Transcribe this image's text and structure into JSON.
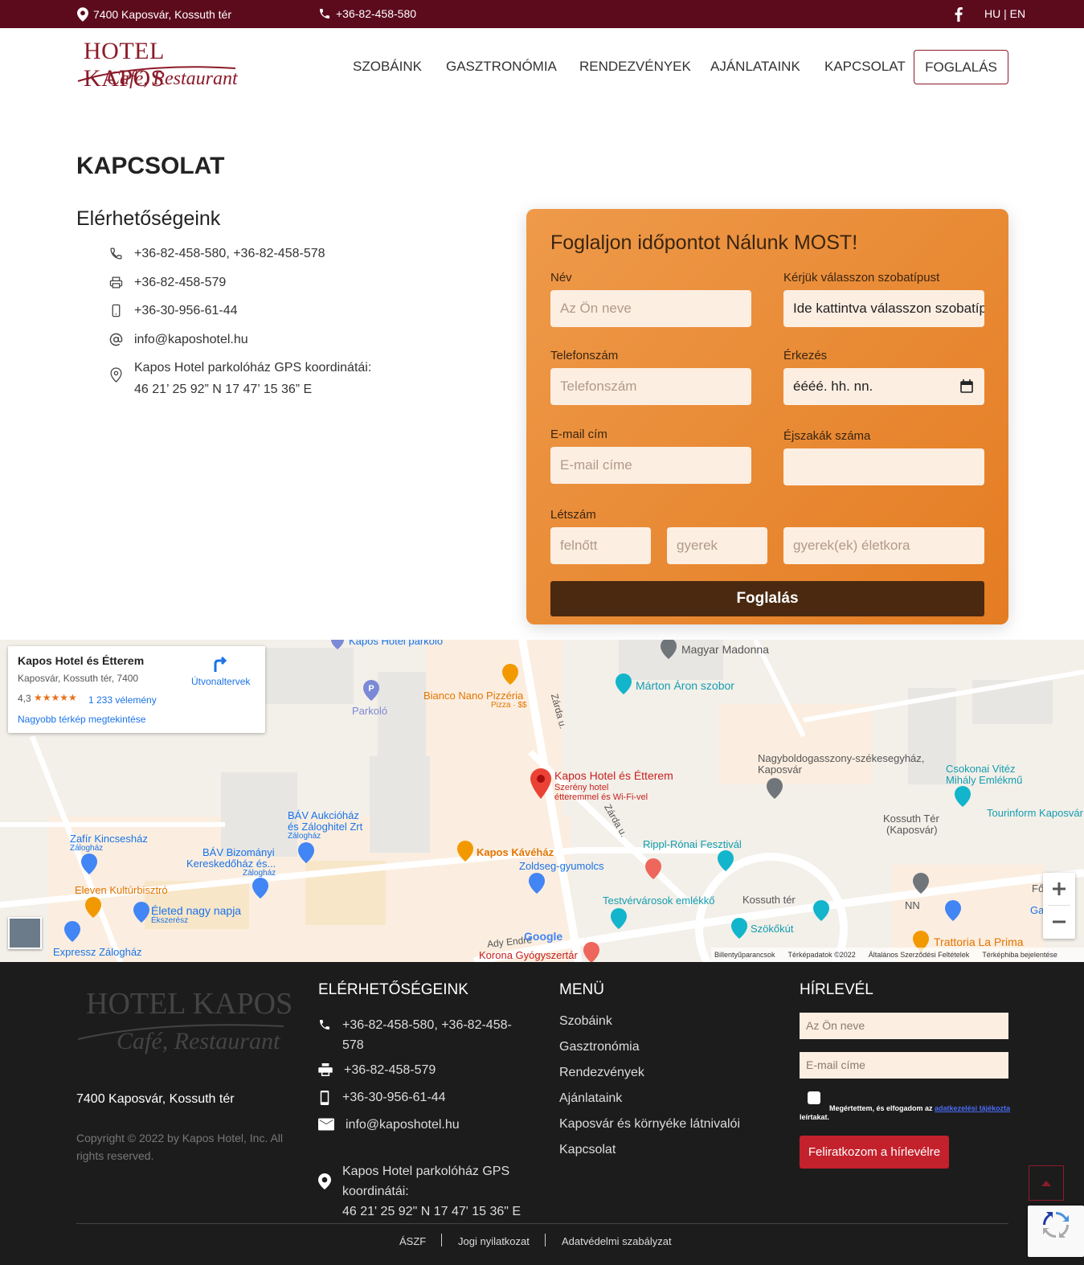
{
  "topbar": {
    "address": "7400 Kaposvár, Kossuth tér",
    "phone": "+36-82-458-580",
    "lang": "HU | EN"
  },
  "logo": {
    "title": "HOTEL KAPOS",
    "subtitle": "Café, Restaurant"
  },
  "nav": {
    "items": [
      "SZOBÁINK",
      "GASZTRONÓMIA",
      "RENDEZVÉNYEK",
      "AJÁNLATAINK",
      "KAPCSOLAT"
    ],
    "cta": "FOGLALÁS"
  },
  "page_title": "KAPCSOLAT",
  "contacts": {
    "heading": "Elérhetőségeink",
    "phone": "+36-82-458-580, +36-82-458-578",
    "fax": "+36-82-458-579",
    "mobile": "+36-30-956-61-44",
    "email": "info@kaposhotel.hu",
    "gps_label": "Kapos Hotel parkolóház GPS koordinátái:",
    "gps_value": "46 21’ 25 92” N 17 47’ 15 36” E"
  },
  "booking": {
    "title": "Foglaljon időpontot Nálunk MOST!",
    "name_label": "Név",
    "name_placeholder": "Az Ön neve",
    "room_label": "Kérjük válasszon szobatípust",
    "room_value": "Ide kattintva válasszon szobatípust",
    "phone_label": "Telefonszám",
    "phone_placeholder": "Telefonszám",
    "arrival_label": "Érkezés",
    "arrival_value": "éééé. hh. nn.",
    "email_label": "E-mail cím",
    "email_placeholder": "E-mail címe",
    "nights_label": "Éjszakák száma",
    "nights_value": "",
    "guests_label": "Létszám",
    "adult_placeholder": "felnőtt",
    "child_placeholder": "gyerek",
    "child_age_placeholder": "gyerek(ek) életkora",
    "submit": "Foglalás"
  },
  "map": {
    "card_title": "Kapos Hotel és Étterem",
    "card_address": "Kaposvár, Kossuth tér, 7400",
    "card_rating": "4,3",
    "card_stars": "★★★★★",
    "card_reviews": "1 233 vélemény",
    "card_link": "Nagyobb térkép megtekintése",
    "card_directions": "Útvonaltervek",
    "pin_title": "Kapos Hotel és Étterem",
    "pin_sub1": "Szerény hotel",
    "pin_sub2": "étteremmel és Wi-Fi-vel",
    "labels": {
      "parkolo_top": "Kapos Hotel parkoló",
      "madonna": "Magyar Madonna",
      "marton": "Márton Áron szobor",
      "bianco": "Bianco Nano Pizzéria",
      "bianco_sub": "Pizza · $$",
      "parkolo": "Parkoló",
      "zarda1": "Zárda u.",
      "zarda2": "Zárda u.",
      "nagyboldog1": "Nagyboldogasszony-székesegyház,",
      "nagyboldog2": "Kaposvár",
      "csokonai1": "Csokonai Vitéz",
      "csokonai2": "Mihály Emlékmű",
      "tourinform": "Tourinform Kaposvár",
      "kossuth_ter1": "Kossuth Tér",
      "kossuth_ter2": "(Kaposvár)",
      "bav1": "BÁV Aukcióház",
      "bav2": "és Záloghitel Zrt",
      "bav_sub": "Zálogház",
      "zafir": "Zafír Kincsesház",
      "zafir_sub": "Zálogház",
      "bav_biz1": "BÁV Bizományi",
      "bav_biz2": "Kereskedőház és...",
      "bav_biz_sub": "Zálogház",
      "kavehaz": "Kapos Kávéház",
      "zoldseg": "Zoldseg-gyumolcs",
      "rippl": "Rippl-Rónai Fesztivál",
      "eleven": "Eleven Kultúrbisztró",
      "eleted": "Életed nagy napja",
      "eleted_sub": "Ékszerész",
      "testver": "Testvérvárosok emlékkő",
      "kossuth_ter": "Kossuth tér",
      "nn": "NN",
      "szokokut": "Szökőkút",
      "expressz": "Expressz Zálogház",
      "ady": "Ady Endre",
      "korona": "Korona Gyógyszertár",
      "trattoria": "Trattoria La Prima",
      "fo": "Fő",
      "ga": "Ga",
      "google": "Google"
    },
    "footer_keys": "Billentyűparancsok",
    "footer_data": "Térképadatok ©2022",
    "footer_terms": "Általános Szerződési Feltételek",
    "footer_report": "Térképhiba bejelentése"
  },
  "footer": {
    "logo_title": "HOTEL KAPOS",
    "logo_subtitle": "Café, Restaurant",
    "address": "7400 Kaposvár, Kossuth tér",
    "copyright": "Copyright © 2022 by Kapos Hotel, Inc. All rights reserved.",
    "contacts_title": "ELÉRHETŐSÉGEINK",
    "phone": "+36-82-458-580, +36-82-458-578",
    "fax": "+36-82-458-579",
    "mobile": "+36-30-956-61-44",
    "email": "info@kaposhotel.hu",
    "gps_label": "Kapos Hotel parkolóház GPS koordinátái:",
    "gps_value": "46 21' 25 92\" N 17 47' 15 36\" E",
    "menu_title": "MENÜ",
    "menu": [
      "Szobáink",
      "Gasztronómia",
      "Rendezvények",
      "Ajánlataink",
      "Kaposvár és környéke látnivalói",
      "Kapcsolat"
    ],
    "newsletter_title": "HÍRLEVÉL",
    "nl_name_placeholder": "Az Ön neve",
    "nl_email_placeholder": "E-mail címe",
    "nl_accept": "Megértettem, és elfogadom az",
    "nl_accept_link": "adatkezelési tájékoztatót",
    "nl_accept_end": "leírtakat.",
    "nl_button": "Feliratkozom a hírlevélre",
    "links": [
      "ÁSZF",
      "Jogi nyilatkozat",
      "Adatvédelmi szabályzat"
    ]
  },
  "colors": {
    "topbar": "#5c0b1d",
    "brand": "#8b1b2a",
    "form_orange": "#e88a34",
    "form_button": "#4a2910",
    "footer_bg": "#1c1c1c",
    "newsletter_button": "#c3212c"
  }
}
